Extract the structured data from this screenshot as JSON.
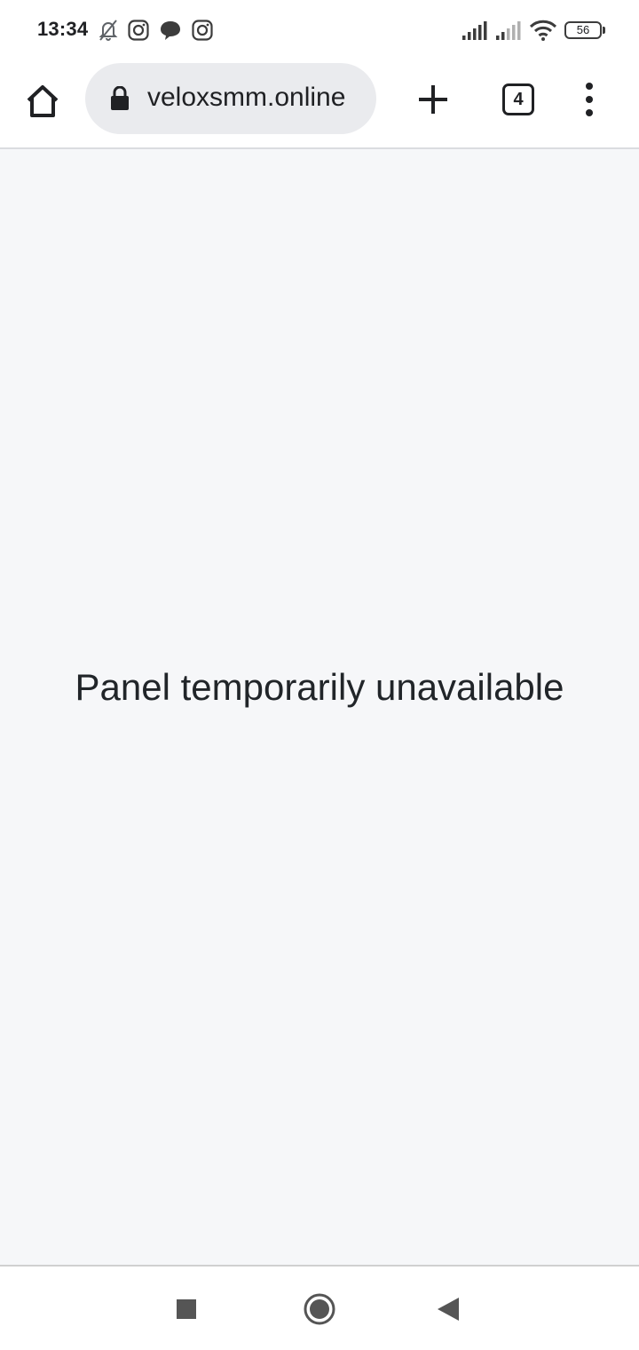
{
  "status_bar": {
    "time": "13:34",
    "icons": [
      "bell-muted-icon",
      "instagram-icon",
      "chat-bubble-icon",
      "instagram-icon",
      "signal-icon",
      "signal-weak-icon",
      "wifi-icon"
    ],
    "battery": "56"
  },
  "browser": {
    "url": "veloxsmm.online",
    "tab_count": "4"
  },
  "page": {
    "message": "Panel temporarily unavailable",
    "background": "#f6f7f9"
  },
  "nav_bar": {
    "icons": [
      "recents-square-icon",
      "home-circle-icon",
      "back-triangle-icon"
    ]
  }
}
